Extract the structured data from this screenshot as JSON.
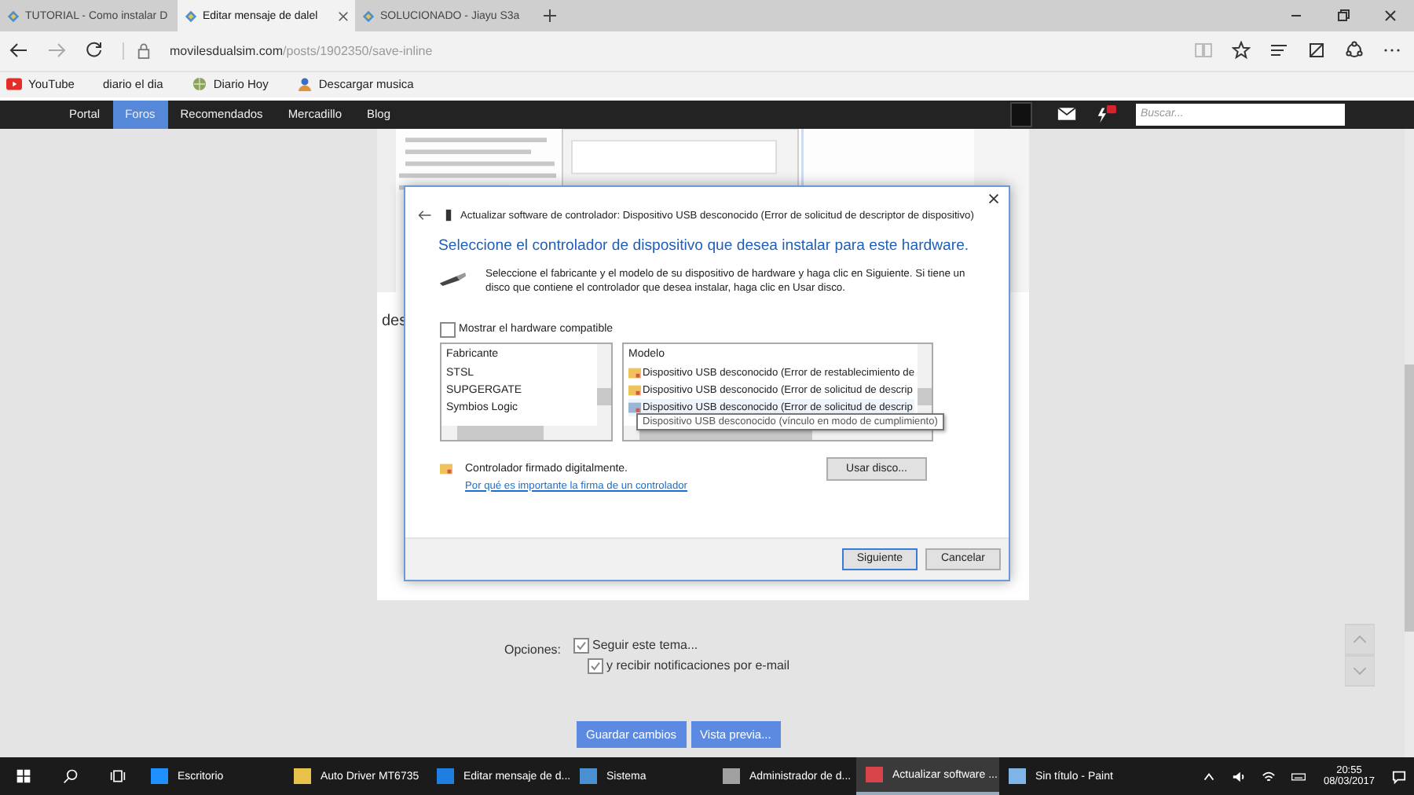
{
  "browser": {
    "tabs": [
      {
        "title": "TUTORIAL - Como instalar D",
        "selected": false
      },
      {
        "title": "Editar mensaje de dalel",
        "selected": true
      },
      {
        "title": "SOLUCIONADO - Jiayu S3a",
        "selected": false
      }
    ],
    "address": {
      "domain": "movilesdualsim.com",
      "path": "/posts/1902350/save-inline"
    },
    "bookmarks": [
      {
        "label": "YouTube",
        "kind": "video"
      },
      {
        "label": "diario el dia",
        "kind": "plain"
      },
      {
        "label": "Diario Hoy",
        "kind": "globe"
      },
      {
        "label": "Descargar musica",
        "kind": "person"
      }
    ]
  },
  "site_nav": {
    "items": [
      {
        "label": "Portal",
        "selected": false
      },
      {
        "label": "Foros",
        "selected": true
      },
      {
        "label": "Recomendados",
        "selected": false
      },
      {
        "label": "Mercadillo",
        "selected": false
      },
      {
        "label": "Blog",
        "selected": false
      }
    ],
    "search": {
      "placeholder": "Buscar..."
    }
  },
  "page": {
    "post_text": "des",
    "options_label": "Opciones:",
    "options": [
      {
        "label": "Seguir este tema...",
        "checked": true
      },
      {
        "label": "y recibir notificaciones por e-mail",
        "checked": true
      }
    ],
    "buttons": [
      "Guardar cambios",
      "Vista previa..."
    ]
  },
  "dialog": {
    "title": "Actualizar software de controlador: Dispositivo USB desconocido (Error de solicitud de descriptor de dispositivo)",
    "heading": "Seleccione el controlador de dispositivo que desea instalar para este hardware.",
    "instructions": "Seleccione el fabricante y el modelo de su dispositivo de hardware y haga clic en Siguiente. Si tiene un disco que contiene el controlador que desea instalar, haga clic en  Usar disco.",
    "compatible": {
      "label": "Mostrar el hardware compatible",
      "checked": false
    },
    "manufacturer": {
      "header": "Fabricante",
      "items": [
        {
          "label": "STSL",
          "selected": false
        },
        {
          "label": "SUPGERGATE",
          "selected": false
        },
        {
          "label": "Symbios Logic",
          "selected": false
        }
      ]
    },
    "model": {
      "header": "Modelo",
      "items": [
        {
          "label": "Dispositivo USB desconocido (Error de restablecimiento de",
          "selected": false
        },
        {
          "label": "Dispositivo USB desconocido (Error de solicitud de descrip",
          "selected": false
        },
        {
          "label": "Dispositivo USB desconocido (Error de solicitud de descrip",
          "selected": true
        }
      ]
    },
    "tooltip": "Dispositivo USB desconocido (vínculo en modo de cumplimiento)",
    "signed": "Controlador firmado digitalmente.",
    "signature_link": "Por qué es importante la firma de un controlador",
    "disk_button": "Usar disco...",
    "buttons": [
      {
        "label": "Siguiente",
        "default": true
      },
      {
        "label": "Cancelar",
        "default": false
      }
    ]
  },
  "taskbar": {
    "items": [
      {
        "label": "Escritorio",
        "active": false,
        "color": "#1e90ff"
      },
      {
        "label": "Auto Driver MT6735",
        "active": false,
        "color": "#e8c24a"
      },
      {
        "label": "Editar mensaje de d...",
        "active": false,
        "color": "#1f7fe0"
      },
      {
        "label": "Sistema",
        "active": false,
        "color": "#4a8fd0"
      },
      {
        "label": "Administrador de d...",
        "active": false,
        "color": "#a0a0a0"
      },
      {
        "label": "Actualizar software ...",
        "active": true,
        "color": "#d9434a"
      },
      {
        "label": "Sin título - Paint",
        "active": false,
        "color": "#7fb4e8"
      }
    ],
    "time": "20:55",
    "date": "08/03/2017"
  }
}
